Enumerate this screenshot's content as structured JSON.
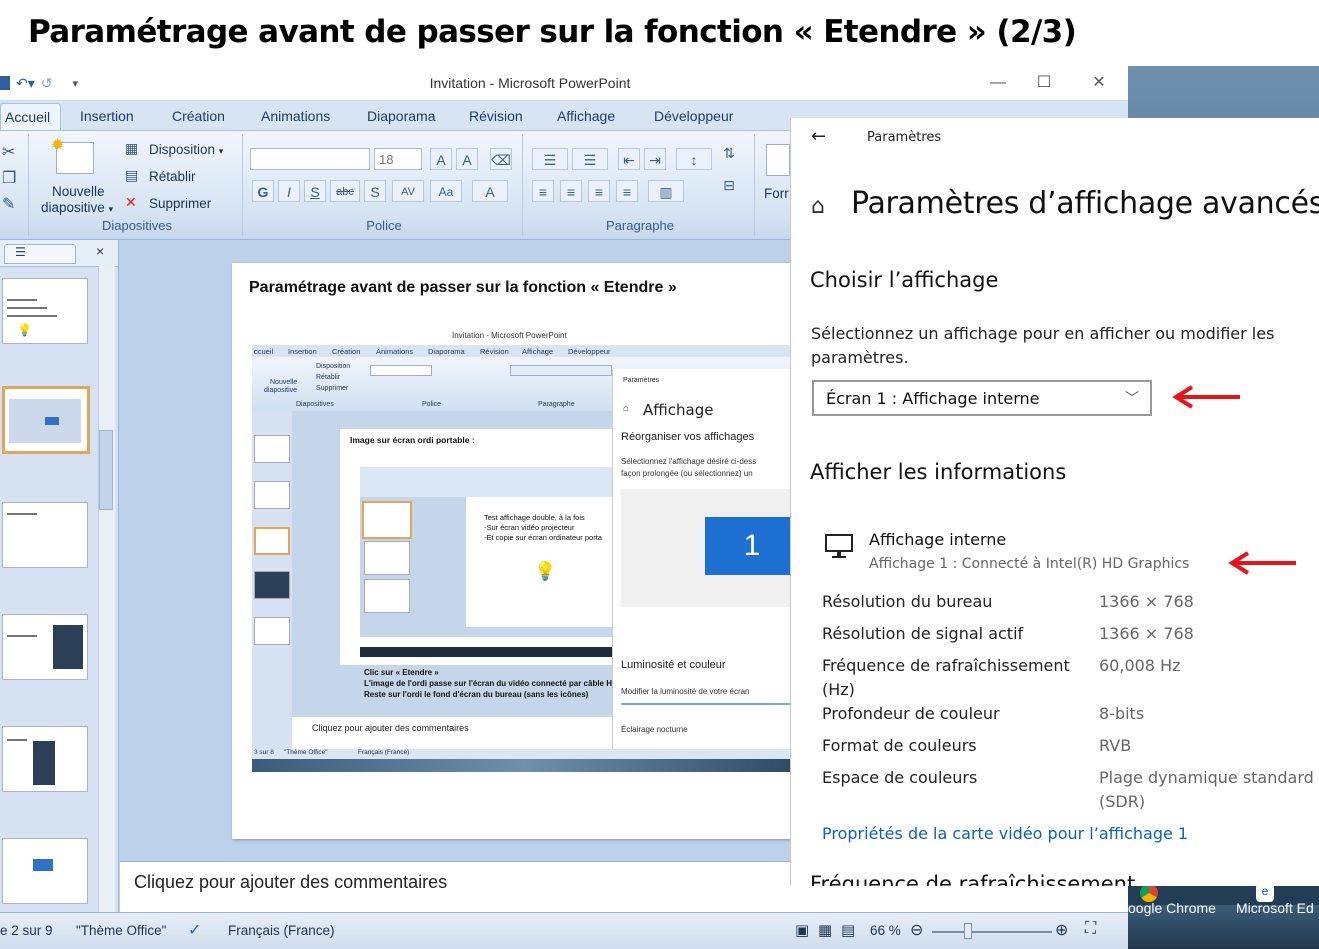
{
  "slide_heading": "Paramétrage avant de passer sur la fonction « Etendre » (2/3)",
  "ppt": {
    "window_title": "Invitation - Microsoft PowerPoint",
    "tabs": [
      "Accueil",
      "Insertion",
      "Création",
      "Animations",
      "Diaporama",
      "Révision",
      "Affichage",
      "Développeur"
    ],
    "groups": {
      "diapositives": {
        "label": "Diapositives",
        "new_slide_line1": "Nouvelle",
        "new_slide_line2": "diapositive",
        "disposition": "Disposition",
        "retablir": "Rétablir",
        "supprimer": "Supprimer"
      },
      "police": {
        "label": "Police",
        "font_size": "18"
      },
      "paragraphe": {
        "label": "Paragraphe"
      },
      "form_partial": "Forr"
    },
    "slide": {
      "title": "Paramétrage avant de passer sur la fonction « Etendre »"
    },
    "comments_placeholder": "Cliquez pour ajouter des commentaires",
    "status": {
      "slide_index": "e 2 sur 9",
      "theme": "\"Thème Office\"",
      "language": "Français (France)",
      "zoom": "66 %"
    }
  },
  "inner_screenshot": {
    "window_title": "Invitation - Microsoft PowerPoint",
    "tabs": [
      "ccueil",
      "Insertion",
      "Création",
      "Animations",
      "Diaporama",
      "Révision",
      "Affichage",
      "Développeur"
    ],
    "groups": [
      "Diapositives",
      "Police",
      "Paragraphe"
    ],
    "ribbon_disposition": "Disposition",
    "ribbon_retablir": "Rétablir",
    "ribbon_supprimer": "Supprimer",
    "ribbon_nouvelle": "Nouvelle",
    "ribbon_diapositive": "diapositive",
    "slide_heading": "Image sur écran ordi portable :",
    "nested_text_line1": "Test affichage double, à la fois",
    "nested_text_line2": "-Sur écran vidéo projecteur",
    "nested_text_line3": "-Et copie sur écran ordinateur porta",
    "caption_line1": "Clic sur « Etendre »",
    "caption_line2": "L'image de l'ordi passe sur l'écran du vidéo connecté par câble HDM",
    "caption_line3": "Reste sur l'ordi le fond d'écran du bureau (sans les icônes)",
    "comments_placeholder": "Cliquez pour ajouter des commentaires",
    "status_slide": "3 sur 8",
    "status_theme": "\"Thème Office\"",
    "status_lang": "Français (France)",
    "settings_label": "Paramètres",
    "affichage_title": "Affichage",
    "reorganiser": "Réorganiser vos affichages",
    "sel_line1": "Sélectionnez l'affichage désiré ci-dess",
    "sel_line2": "façon prolongée (ou sélectionnez) un",
    "display_number": "1",
    "luminosite": "Luminosité et couleur",
    "modifier": "Modifier la luminosité de votre écran",
    "eclairage": "Éclairage nocturne"
  },
  "settings": {
    "breadcrumb": "Paramètres",
    "title": "Paramètres d’affichage avancés",
    "choose_heading": "Choisir l’affichage",
    "choose_desc_line1": "Sélectionnez un affichage pour en afficher ou modifier les",
    "choose_desc_line2": "paramètres.",
    "dropdown_value": "Écran 1 : Affichage interne",
    "info_heading": "Afficher les informations",
    "display_name": "Affichage interne",
    "display_sub": "Affichage 1 : Connecté à Intel(R) HD Graphics",
    "rows": [
      {
        "label": "Résolution du bureau",
        "value": "1366 × 768"
      },
      {
        "label": "Résolution de signal actif",
        "value": "1366 × 768"
      },
      {
        "label": "Fréquence de rafraîchissement",
        "label2": "(Hz)",
        "value": "60,008 Hz"
      },
      {
        "label": "Profondeur de couleur",
        "value": "8-bits"
      },
      {
        "label": "Format de couleurs",
        "value": "RVB"
      },
      {
        "label": "Espace de couleurs",
        "value": "Plage dynamique standard",
        "value2": "(SDR)"
      }
    ],
    "link": "Propriétés de la carte vidéo pour l’affichage 1",
    "cut_heading": "Fréquence de rafraîchissement"
  },
  "taskbar": {
    "chrome": "oogle Chrome",
    "edge": "Microsoft Ed"
  },
  "colors": {
    "arrow_red": "#e8141c",
    "link_blue": "#0a63b8",
    "ribbon_blue": "#d7e4f4"
  }
}
